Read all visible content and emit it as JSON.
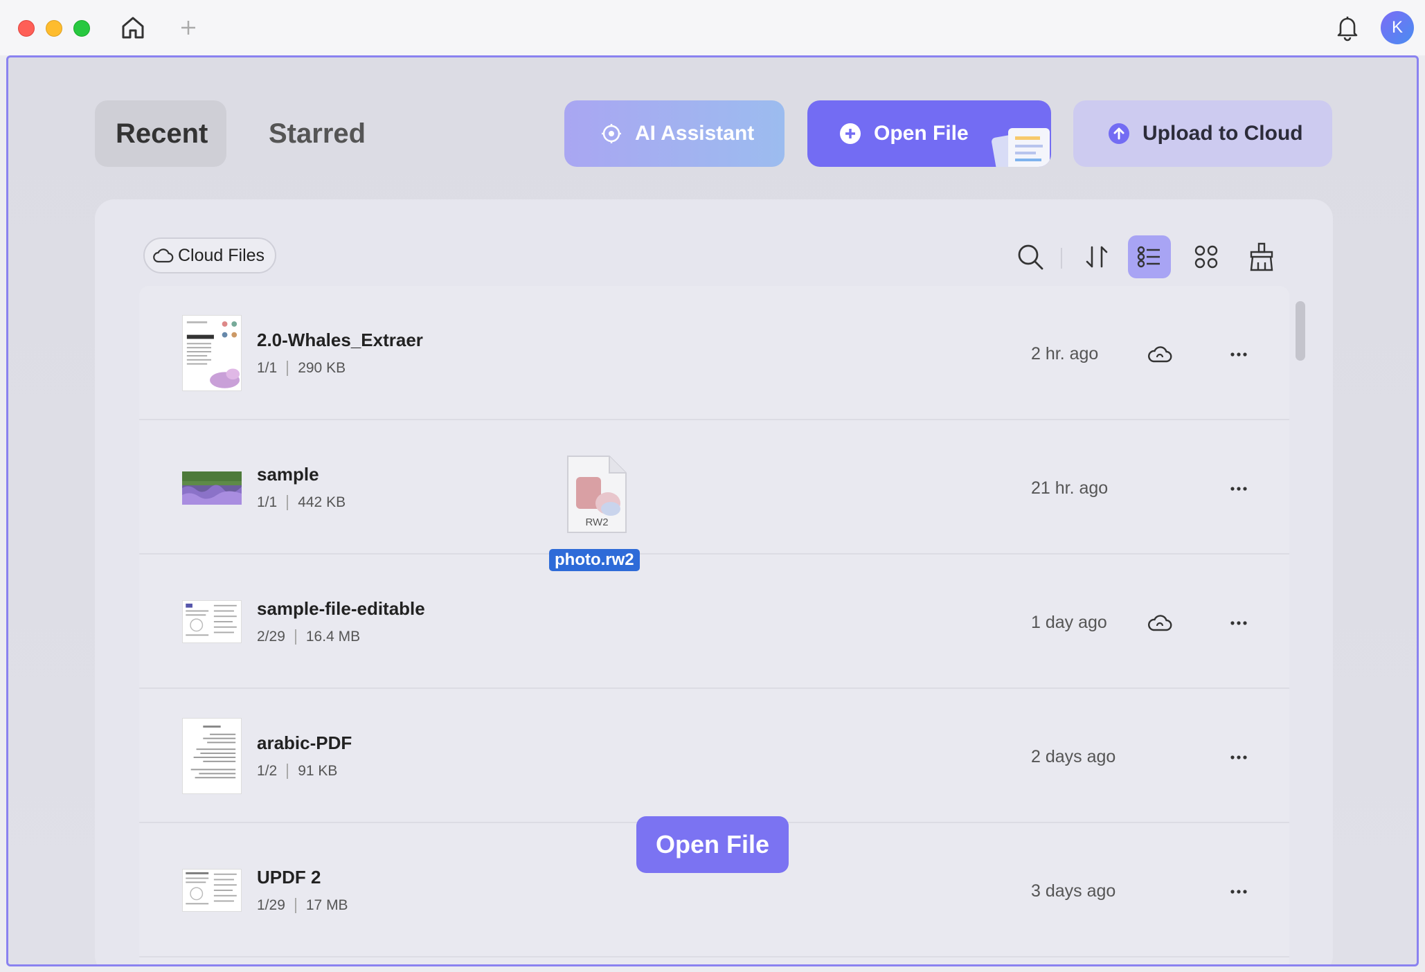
{
  "titlebar": {
    "avatar_letter": "K"
  },
  "tabs": [
    {
      "label": "Recent",
      "active": true
    },
    {
      "label": "Starred",
      "active": false
    }
  ],
  "actions": {
    "ai_label": "AI Assistant",
    "open_label": "Open File",
    "upload_label": "Upload to Cloud"
  },
  "toolbar": {
    "cloud_files_label": "Cloud Files",
    "view_mode": "list"
  },
  "files": [
    {
      "name": "2.0-Whales_Extraer",
      "pages": "1/1",
      "size": "290 KB",
      "time": "2 hr. ago",
      "cloud": true
    },
    {
      "name": "sample",
      "pages": "1/1",
      "size": "442 KB",
      "time": "21 hr. ago",
      "cloud": false
    },
    {
      "name": "sample-file-editable",
      "pages": "2/29",
      "size": "16.4 MB",
      "time": "1 day ago",
      "cloud": true
    },
    {
      "name": "arabic-PDF",
      "pages": "1/2",
      "size": "91 KB",
      "time": "2 days ago",
      "cloud": false
    },
    {
      "name": "UPDF 2",
      "pages": "1/29",
      "size": "17 MB",
      "time": "3 days ago",
      "cloud": false
    }
  ],
  "drag": {
    "file_label": "photo.rw2",
    "file_ext": "RW2",
    "drop_hint": "Open File"
  },
  "colors": {
    "accent": "#736cf3",
    "window_border": "#8a82f0"
  }
}
